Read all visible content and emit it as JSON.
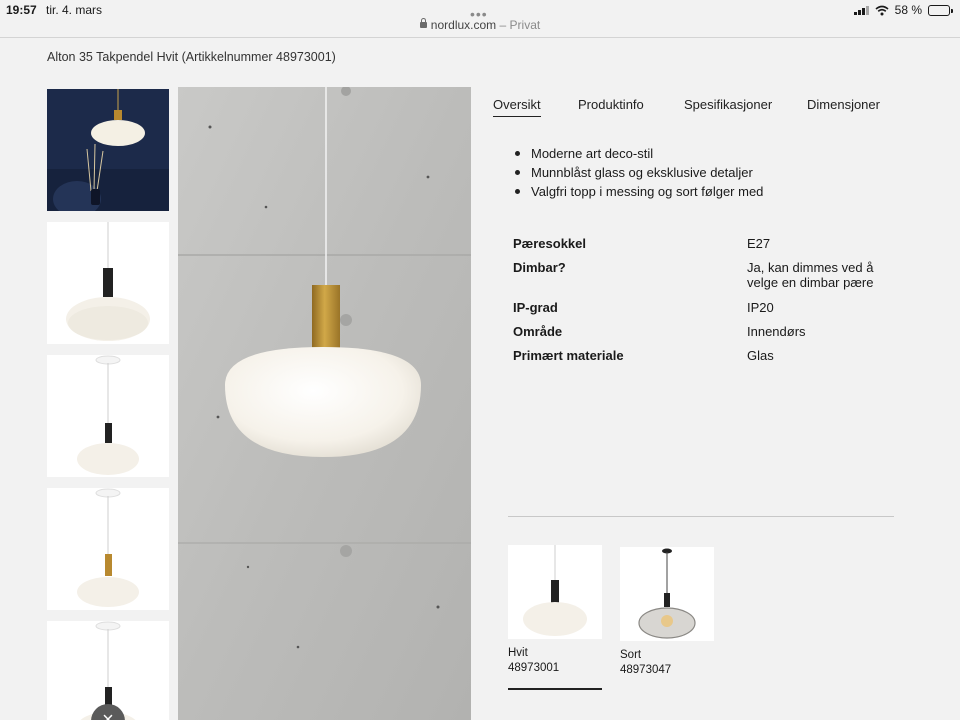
{
  "status_bar": {
    "time": "19:57",
    "date": "tir. 4. mars",
    "battery": "58 %",
    "battery_level": 0.58
  },
  "browser": {
    "domain": "nordlux.com",
    "mode": "– Privat"
  },
  "product": {
    "title": "Alton 35 Takpendel Hvit  (Artikkelnummer 48973001)"
  },
  "tabs": [
    {
      "label": "Oversikt",
      "active": true
    },
    {
      "label": "Produktinfo",
      "active": false
    },
    {
      "label": "Spesifikasjoner",
      "active": false
    },
    {
      "label": "Dimensjoner",
      "active": false
    }
  ],
  "features": [
    "Moderne art deco-stil",
    "Munnblåst glass og eksklusive detaljer",
    "Valgfri topp i messing og sort følger med"
  ],
  "specs": [
    {
      "key": "Pæresokkel",
      "value": "E27"
    },
    {
      "key": "Dimbar?",
      "value": "Ja, kan dimmes ved å velge en dimbar pære"
    },
    {
      "key": "IP-grad",
      "value": "IP20"
    },
    {
      "key": "Område",
      "value": "Innendørs"
    },
    {
      "key": "Primært materiale",
      "value": "Glas"
    }
  ],
  "variants": [
    {
      "name": "Hvit",
      "number": "48973001",
      "selected": true
    },
    {
      "name": "Sort",
      "number": "48973047",
      "selected": false
    }
  ],
  "colors": {
    "brass": "#b8892f",
    "navy": "#1c2a4a",
    "concrete": "#bdbdbb"
  }
}
